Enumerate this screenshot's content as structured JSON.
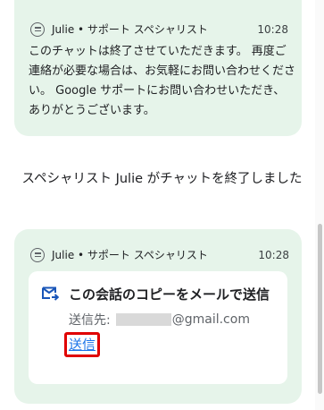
{
  "top_message": {
    "sender": "Julie • サポート スペシャリスト",
    "time": "10:28",
    "text": "このチャットは終了させていただきます。 再度ご連絡が必要な場合は、お気軽にお問い合わせください。 Google サポートにお問い合わせいただき、ありがとうございます。"
  },
  "system_message": "スペシャリスト Julie がチャットを終了しました",
  "bottom_message": {
    "sender": "Julie • サポート スペシャリスト",
    "time": "10:28",
    "card": {
      "title": "この会話のコピーをメールで送信",
      "recipient_label": "送信先:",
      "recipient_domain": "@gmail.com",
      "send_label": "送信"
    }
  },
  "colors": {
    "bubble_bg": "#e6f4ea",
    "link": "#1a73e8",
    "highlight_border": "#e00000"
  },
  "icons": [
    "support-agent-icon",
    "mail-send-icon"
  ]
}
